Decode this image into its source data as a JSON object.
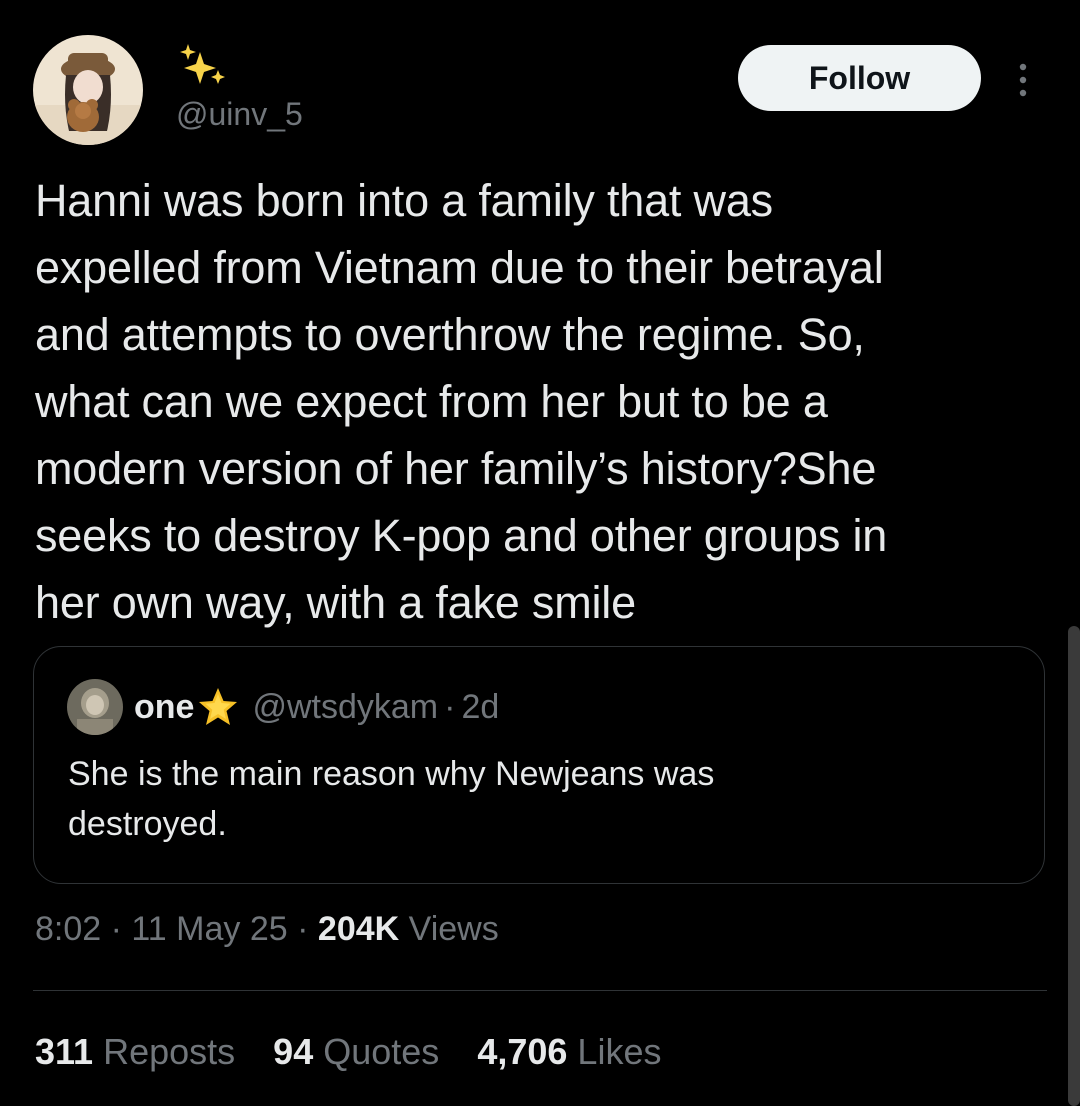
{
  "author": {
    "name_emoji": "✨",
    "handle": "@uinv_5",
    "avatar": "avatar-photo"
  },
  "follow_label": "Follow",
  "more_icon": "more-vertical-icon",
  "tweet_text": "Hanni was born into a family that was\nexpelled from Vietnam due to their betrayal\nand attempts to overthrow the regime. So,\nwhat can we expect from her but to be a\nmodern version of her family’s history?She\nseeks to destroy K-pop and other groups in\nher own way, with a fake smile",
  "quote": {
    "name": "one",
    "name_emoji": "🌟",
    "handle": "@wtsdykam",
    "separator": "·",
    "time": "2d",
    "text": "She is the main reason why Newjeans was\ndestroyed."
  },
  "meta": {
    "time": "8:02",
    "separator": "·",
    "date": "11 May 25",
    "views_count": "204K",
    "views_label": "Views"
  },
  "stats": {
    "reposts_count": "311",
    "reposts_label": "Reposts",
    "quotes_count": "94",
    "quotes_label": "Quotes",
    "likes_count": "4,706",
    "likes_label": "Likes"
  },
  "colors": {
    "background": "#000000",
    "text": "#e7e9ea",
    "secondary": "#71767b",
    "border": "#2f3336",
    "follow_bg": "#eff3f4"
  }
}
